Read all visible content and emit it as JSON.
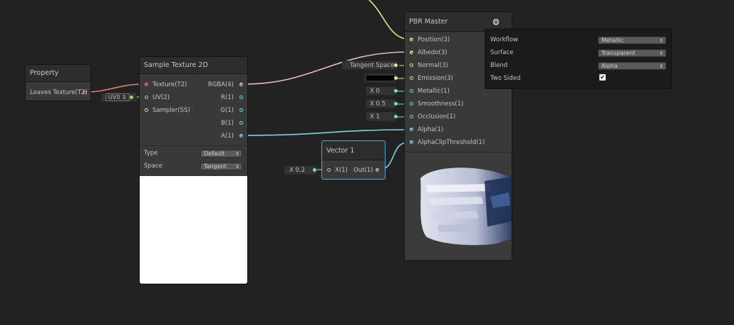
{
  "property_node": {
    "title": "Property",
    "output_label": "Leaves Texture(T2)"
  },
  "sample_node": {
    "title": "Sample Texture 2D",
    "inputs": [
      "Texture(T2)",
      "UV(2)",
      "Sampler(SS)"
    ],
    "outputs": [
      "RGBA(4)",
      "R(1)",
      "G(1)",
      "B(1)",
      "A(1)"
    ],
    "uv_default": "UV0",
    "type_label": "Type",
    "type_value": "Default",
    "space_label": "Space",
    "space_value": "Tangent"
  },
  "vector_node": {
    "title": "Vector 1",
    "input_label": "X(1)",
    "output_label": "Out(1)",
    "x_field": "X  0.2"
  },
  "master_node": {
    "title": "PBR Master",
    "inputs": [
      "Position(3)",
      "Albedo(3)",
      "Normal(3)",
      "Emission(3)",
      "Metallic(1)",
      "Smoothness(1)",
      "Occlusion(1)",
      "Alpha(1)",
      "AlphaClipThreshold(1)"
    ],
    "normal_default": "Tangent Space",
    "metallic_default": "X  0",
    "smoothness_default": "X  0.5",
    "occlusion_default": "X  1",
    "emission_color": "#000000"
  },
  "settings_panel": {
    "rows": [
      {
        "label": "Workflow",
        "value": "Metallic"
      },
      {
        "label": "Surface",
        "value": "Transparent"
      },
      {
        "label": "Blend",
        "value": "Alpha"
      }
    ],
    "two_sided_label": "Two Sided",
    "two_sided_checked": true
  },
  "icons": {
    "gear": "gear-icon",
    "checkbox": "checkbox-icon",
    "dropdown": "dropdown-arrow-icon"
  },
  "colors": {
    "background": "#222222",
    "node": "#393939",
    "wire_texture": "#e07a7a",
    "wire_vector4": "#e4b8d4",
    "wire_vector3": "#ece08a",
    "wire_float": "#7fd4e0",
    "selection": "#5aa7c7"
  }
}
